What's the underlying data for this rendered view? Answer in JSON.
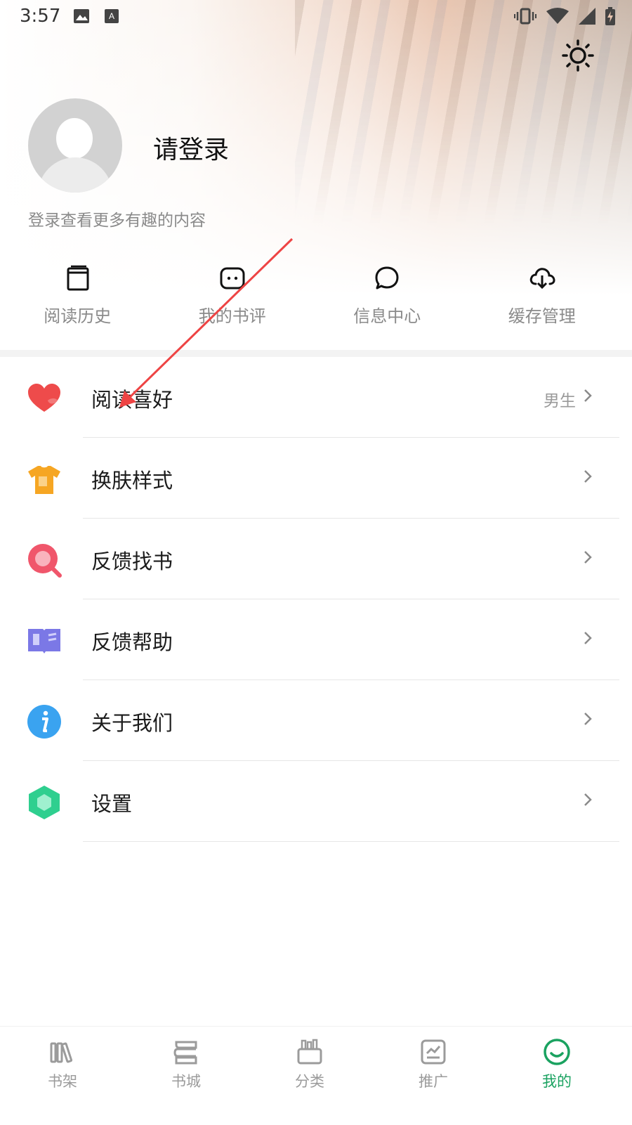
{
  "status_bar": {
    "time": "3:57",
    "left_icons": [
      "image-icon",
      "keyboard-a-icon"
    ],
    "right_icons": [
      "vibrate-icon",
      "wifi-icon",
      "signal-icon",
      "battery-charging-icon"
    ]
  },
  "header": {
    "brightness_icon": "sun-icon",
    "login_title": "请登录",
    "login_subtitle": "登录查看更多有趣的内容"
  },
  "quick_actions": [
    {
      "label": "阅读历史",
      "icon": "book-icon"
    },
    {
      "label": "我的书评",
      "icon": "comment-box-icon"
    },
    {
      "label": "信息中心",
      "icon": "chat-bubble-icon"
    },
    {
      "label": "缓存管理",
      "icon": "cloud-download-icon"
    }
  ],
  "menu": [
    {
      "label": "阅读喜好",
      "value": "男生",
      "icon": "heart-icon",
      "color": "#ee4b4b"
    },
    {
      "label": "换肤样式",
      "value": "",
      "icon": "tshirt-icon",
      "color": "#f6a623"
    },
    {
      "label": "反馈找书",
      "value": "",
      "icon": "search-icon",
      "color": "#f0566b"
    },
    {
      "label": "反馈帮助",
      "value": "",
      "icon": "open-book-icon",
      "color": "#7b78e6"
    },
    {
      "label": "关于我们",
      "value": "",
      "icon": "info-icon",
      "color": "#3aa3f0"
    },
    {
      "label": "设置",
      "value": "",
      "icon": "hexagon-settings-icon",
      "color": "#2fcf8f"
    }
  ],
  "bottom_nav": {
    "active": "我的",
    "active_color": "#1aa260",
    "items": [
      {
        "label": "书架",
        "icon": "bookshelf-icon"
      },
      {
        "label": "书城",
        "icon": "book-stack-icon"
      },
      {
        "label": "分类",
        "icon": "category-box-icon"
      },
      {
        "label": "推广",
        "icon": "promo-chart-icon"
      },
      {
        "label": "我的",
        "icon": "smile-face-icon"
      }
    ]
  }
}
